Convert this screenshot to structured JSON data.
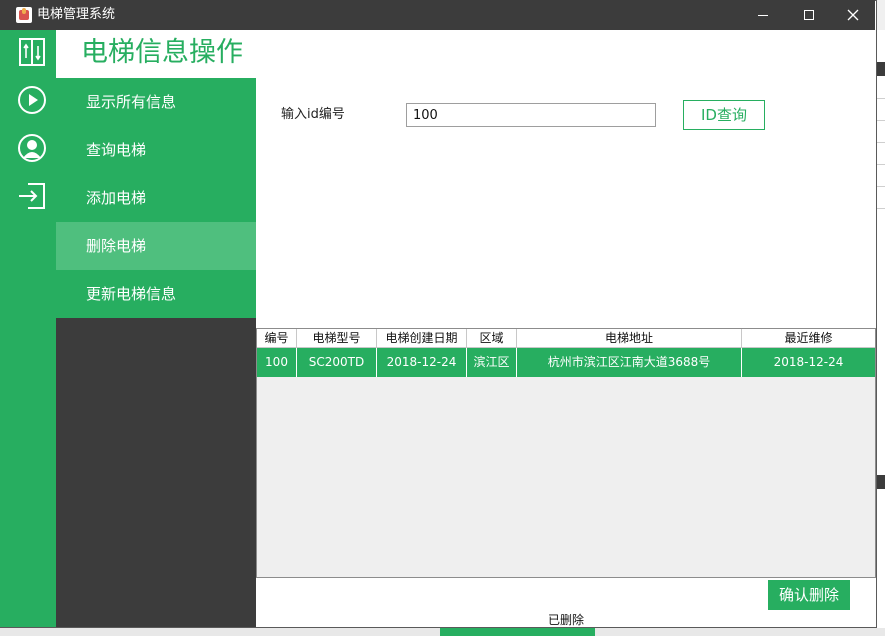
{
  "window": {
    "title": "电梯管理系统",
    "controls": {
      "minimize": "minimize-icon",
      "maximize": "maximize-icon",
      "close": "close-icon"
    }
  },
  "rail": {
    "icons": [
      "elevator-icon",
      "play-icon",
      "user-icon",
      "logout-icon"
    ]
  },
  "menu": {
    "title": "电梯信息操作",
    "items": [
      {
        "label": "显示所有信息",
        "active": false
      },
      {
        "label": "查询电梯",
        "active": false
      },
      {
        "label": "添加电梯",
        "active": false
      },
      {
        "label": "删除电梯",
        "active": true
      },
      {
        "label": "更新电梯信息",
        "active": false
      }
    ]
  },
  "form": {
    "id_label": "输入id编号",
    "id_value": "100",
    "query_button": "ID查询"
  },
  "table": {
    "columns": [
      "编号",
      "电梯型号",
      "电梯创建日期",
      "区域",
      "电梯地址",
      "最近维修"
    ],
    "rows": [
      [
        "100",
        "SC200TD",
        "2018-12-24",
        "滨江区",
        "杭州市滨江区江南大道3688号",
        "2018-12-24"
      ]
    ]
  },
  "actions": {
    "confirm_delete": "确认删除",
    "status": "已删除"
  },
  "colors": {
    "accent": "#27ae60",
    "accent_light": "#4fbf7e",
    "dark": "#3c3c3c"
  }
}
